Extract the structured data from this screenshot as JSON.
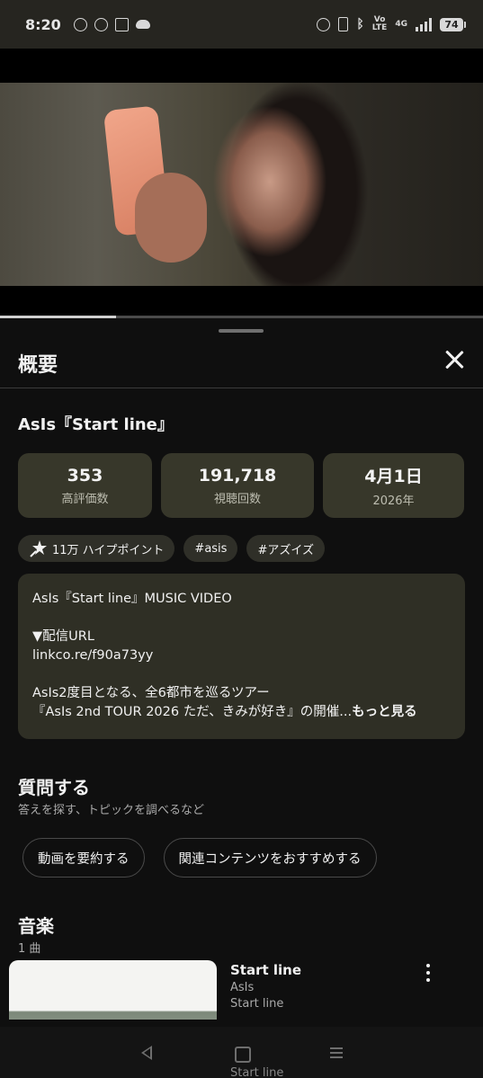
{
  "status_bar": {
    "time": "8:20",
    "left_icons": [
      "line-icon",
      "openai-icon",
      "gmail-icon",
      "cloud-icon"
    ],
    "right_icons": [
      "alarm-icon",
      "vibrate-icon",
      "bluetooth-icon",
      "volte-icon",
      "4g-signal-icon",
      "signal-icon"
    ],
    "volte_label_top": "Vo",
    "volte_label_bottom": "LTE",
    "network_label": "4G",
    "battery": "74"
  },
  "video": {
    "progress": 0.24
  },
  "sheet": {
    "title": "概要",
    "video_title": "AsIs『Start line』",
    "stats": [
      {
        "value": "353",
        "label": "高評価数"
      },
      {
        "value": "191,718",
        "label": "視聴回数"
      },
      {
        "value": "4月1日",
        "label": "2026年"
      }
    ],
    "chips": [
      {
        "label": "11万 ハイプポイント",
        "icon": "hype-icon"
      },
      {
        "label": "#asis"
      },
      {
        "label": "#アズイズ"
      }
    ],
    "description": {
      "line1": "AsIs『Start line』MUSIC VIDEO",
      "line2": "▼配信URL",
      "line3": "linkco.re/f90a73yy",
      "line4": "AsIs2度目となる、全6都市を巡るツアー",
      "line5": "『AsIs 2nd TOUR 2026 ただ、きみが好き』の開催...",
      "more": "もっと見る"
    },
    "ask": {
      "title": "質問する",
      "subtitle": "答えを探す、トピックを調べるなど",
      "buttons": [
        "動画を要約する",
        "関連コンテンツをおすすめする"
      ]
    },
    "music": {
      "title": "音楽",
      "count": "1 曲",
      "track": {
        "name": "Start line",
        "artist": "AsIs",
        "album": "Start line"
      },
      "peek_text": "Start line"
    }
  },
  "nav": {
    "icons": [
      "back-icon",
      "home-icon",
      "recents-icon"
    ]
  }
}
